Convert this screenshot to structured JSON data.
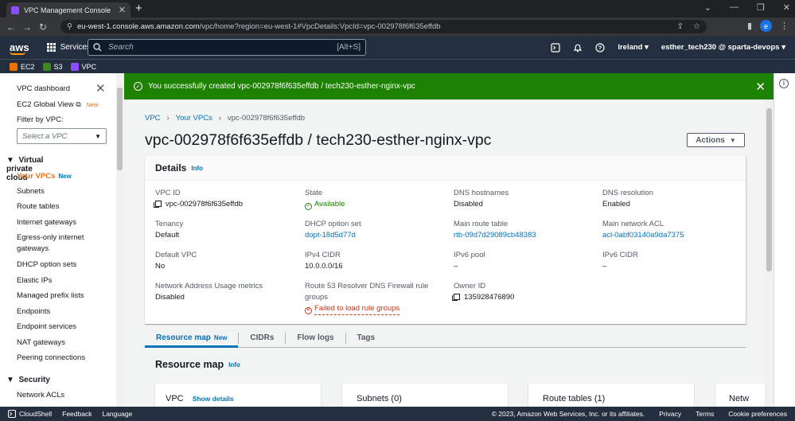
{
  "browser": {
    "tab_title": "VPC Management Console",
    "url_host": "eu-west-1.console.aws.amazon.com",
    "url_path": "/vpc/home?region=eu-west-1#VpcDetails:VpcId=vpc-002978f6f635effdb",
    "profile_initial": "e"
  },
  "aws_nav": {
    "logo": "aws",
    "services": "Services",
    "search_placeholder": "Search",
    "search_shortcut": "[Alt+S]",
    "region": "Ireland",
    "account": "esther_tech230 @ sparta-devops"
  },
  "favorites": [
    {
      "label": "EC2",
      "color": "#ed7100"
    },
    {
      "label": "S3",
      "color": "#3f8624"
    },
    {
      "label": "VPC",
      "color": "#8c4fff"
    }
  ],
  "sidebar": {
    "dashboard": "VPC dashboard",
    "ec2_global_view": "EC2 Global View",
    "new_label": "New",
    "filter_label": "Filter by VPC:",
    "filter_placeholder": "Select a VPC",
    "section_vpc": "Virtual private cloud",
    "your_vpcs": "Your VPCs",
    "your_vpcs_new": "New",
    "items": [
      "Subnets",
      "Route tables",
      "Internet gateways",
      "Egress-only internet gateways",
      "DHCP option sets",
      "Elastic IPs",
      "Managed prefix lists",
      "Endpoints",
      "Endpoint services",
      "NAT gateways",
      "Peering connections"
    ],
    "section_security": "Security",
    "security_items": [
      "Network ACLs"
    ]
  },
  "flash": {
    "message": "You successfully created vpc-002978f6f635effdb / tech230-esther-nginx-vpc"
  },
  "breadcrumb": {
    "root": "VPC",
    "parent": "Your VPCs",
    "current": "vpc-002978f6f635effdb"
  },
  "page": {
    "title": "vpc-002978f6f635effdb / tech230-esther-nginx-vpc",
    "actions": "Actions"
  },
  "details": {
    "heading": "Details",
    "info": "Info",
    "vpc_id": {
      "label": "VPC ID",
      "value": "vpc-002978f6f635effdb"
    },
    "state": {
      "label": "State",
      "value": "Available"
    },
    "dns_hostnames": {
      "label": "DNS hostnames",
      "value": "Disabled"
    },
    "dns_resolution": {
      "label": "DNS resolution",
      "value": "Enabled"
    },
    "tenancy": {
      "label": "Tenancy",
      "value": "Default"
    },
    "dhcp": {
      "label": "DHCP option set",
      "value": "dopt-18d5d77d"
    },
    "main_route_table": {
      "label": "Main route table",
      "value": "rtb-09d7d29089cb48383"
    },
    "main_acl": {
      "label": "Main network ACL",
      "value": "acl-0abf03140a9da7375"
    },
    "default_vpc": {
      "label": "Default VPC",
      "value": "No"
    },
    "ipv4": {
      "label": "IPv4 CIDR",
      "value": "10.0.0.0/16"
    },
    "ipv6_pool": {
      "label": "IPv6 pool",
      "value": "–"
    },
    "ipv6_cidr": {
      "label": "IPv6 CIDR",
      "value": "–"
    },
    "nau": {
      "label": "Network Address Usage metrics",
      "value": "Disabled"
    },
    "r53": {
      "label": "Route 53 Resolver DNS Firewall rule groups",
      "value": "Failed to load rule groups"
    },
    "owner": {
      "label": "Owner ID",
      "value": "135928476890"
    }
  },
  "tabs": [
    {
      "label": "Resource map",
      "badge": "New"
    },
    {
      "label": "CIDRs"
    },
    {
      "label": "Flow logs"
    },
    {
      "label": "Tags"
    }
  ],
  "resource_map": {
    "title": "Resource map",
    "info": "Info",
    "vpc": "VPC",
    "show_details": "Show details",
    "subnets": "Subnets (0)",
    "route_tables": "Route tables (1)",
    "network": "Netw"
  },
  "footer": {
    "cloudshell": "CloudShell",
    "feedback": "Feedback",
    "language": "Language",
    "copyright": "© 2023, Amazon Web Services, Inc. or its affiliates.",
    "privacy": "Privacy",
    "terms": "Terms",
    "cookies": "Cookie preferences"
  },
  "colors": {
    "aws_nav": "#232f3e",
    "success": "#1d8102",
    "link": "#0073bb",
    "error": "#d13212"
  }
}
